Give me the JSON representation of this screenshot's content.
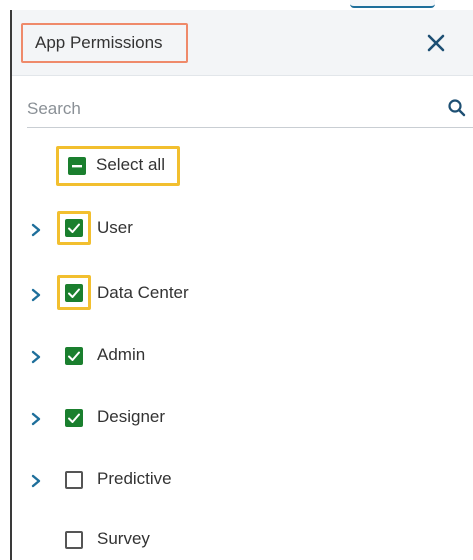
{
  "panel": {
    "title": "App Permissions",
    "close_icon": "close-icon"
  },
  "search": {
    "placeholder": "Search",
    "value": "",
    "icon": "search-icon"
  },
  "select_all": {
    "label": "Select all",
    "state": "partial"
  },
  "items": [
    {
      "label": "User",
      "state": "checked",
      "expandable": true
    },
    {
      "label": "Data Center",
      "state": "checked",
      "expandable": true
    },
    {
      "label": "Admin",
      "state": "checked",
      "expandable": true
    },
    {
      "label": "Designer",
      "state": "checked",
      "expandable": true
    },
    {
      "label": "Predictive",
      "state": "unchecked",
      "expandable": true
    },
    {
      "label": "Survey",
      "state": "unchecked",
      "expandable": false
    }
  ],
  "colors": {
    "checkbox_green": "#1a7f2e",
    "chevron_blue": "#1e6f9b",
    "title_highlight": "#ef8a6a",
    "item_highlight": "#f2bf2f"
  }
}
